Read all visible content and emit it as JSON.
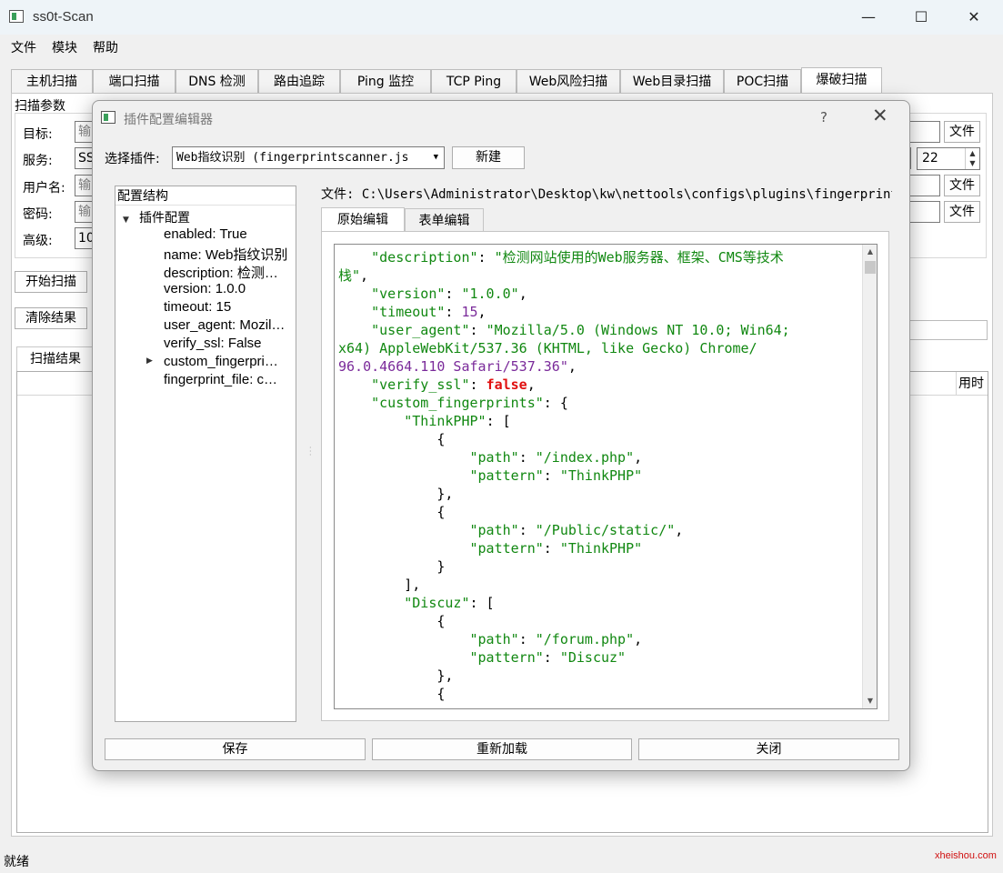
{
  "window": {
    "title": "ss0t-Scan",
    "minimize": "—",
    "maximize": "☐",
    "close": "✕"
  },
  "menu": [
    "文件",
    "模块",
    "帮助"
  ],
  "tabs": [
    "主机扫描",
    "端口扫描",
    "DNS 检测",
    "路由追踪",
    "Ping 监控",
    "TCP Ping",
    "Web风险扫描",
    "Web目录扫描",
    "POC扫描",
    "爆破扫描"
  ],
  "active_tab_index": 9,
  "scan_params": {
    "group_label": "扫描参数",
    "target_label": "目标:",
    "target_placeholder": "输",
    "service_label": "服务:",
    "service_value": "SS",
    "username_label": "用户名:",
    "username_placeholder": "输",
    "password_label": "密码:",
    "password_placeholder": "输",
    "advanced_label": "高级:",
    "advanced_value": "10",
    "file_btn": "文件",
    "port_value": "22"
  },
  "actions": {
    "start": "开始扫描",
    "clear": "清除结果"
  },
  "results": {
    "tab": "扫描结果",
    "col_time": "用时"
  },
  "status": "就绪",
  "watermark": "xheishou.com",
  "dialog": {
    "title": "插件配置编辑器",
    "help": "?",
    "close": "✕",
    "plugin_label": "选择插件:",
    "plugin_selected": "Web指纹识别 (fingerprintscanner.js",
    "new_btn": "新建",
    "tree_header": "配置结构",
    "tree_root": "插件配置",
    "tree_items": [
      "enabled: True",
      "name: Web指纹识别",
      "description: 检测…",
      "version: 1.0.0",
      "timeout: 15",
      "user_agent: Mozil…",
      "verify_ssl: False",
      "custom_fingerpri…",
      "fingerprint_file: c…"
    ],
    "file_path": "文件: C:\\Users\\Administrator\\Desktop\\kw\\nettools\\configs\\plugins\\fingerprintsca",
    "editor_tabs": [
      "原始编辑",
      "表单编辑"
    ],
    "buttons": {
      "save": "保存",
      "reload": "重新加载",
      "close": "关闭"
    }
  }
}
